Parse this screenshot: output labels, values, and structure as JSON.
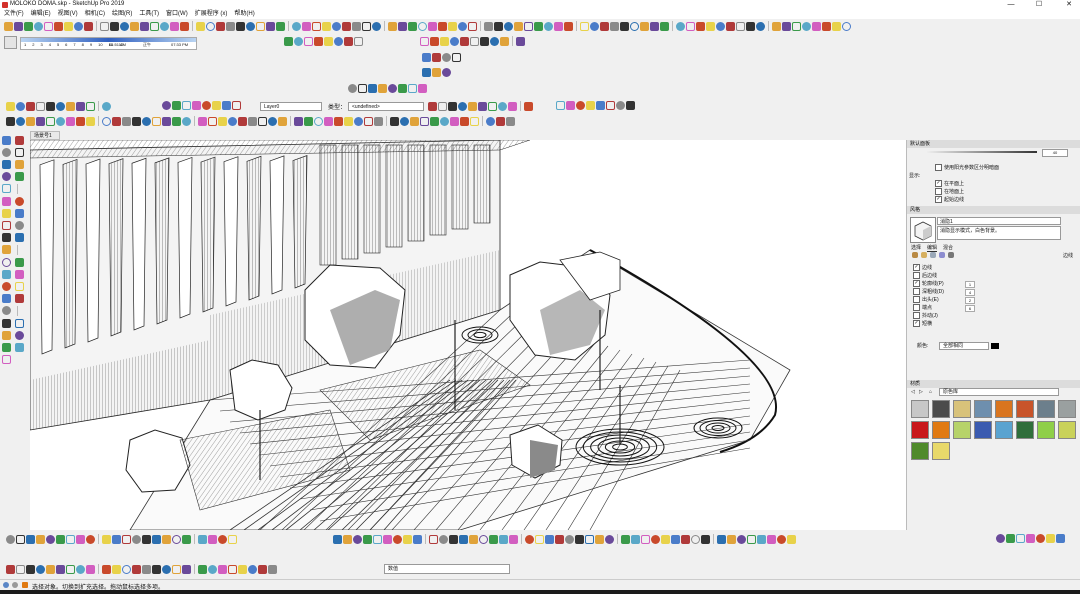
{
  "window": {
    "title": "MOLOKO DOMA.skp - SketchUp Pro 2019",
    "minimize": "—",
    "maximize": "☐",
    "close": "✕"
  },
  "menu": [
    "文件(F)",
    "编辑(E)",
    "视图(V)",
    "相机(C)",
    "绘图(R)",
    "工具(T)",
    "窗口(W)",
    "扩展程序 (x)",
    "帮助(H)"
  ],
  "shadow": {
    "months": [
      "1",
      "2",
      "3",
      "4",
      "5",
      "6",
      "7",
      "8",
      "9",
      "10",
      "11",
      "12"
    ],
    "start_time": "04:51 AM",
    "noon": "正午",
    "end_time": "07:33 PM"
  },
  "layer_bar": {
    "layer": "Layer0",
    "type_label": "类型：",
    "type_value": "<undefined>"
  },
  "scene_tab": "场景号1",
  "tray": {
    "default_panel": "默认面板",
    "slider_value": "40",
    "use_sun": "使用阳光参数区分明暗面",
    "display_label": "显示:",
    "display_options": [
      {
        "label": "在平面上",
        "checked": true
      },
      {
        "label": "在地面上",
        "checked": false
      },
      {
        "label": "起始边线",
        "checked": true
      }
    ],
    "styles_header": "风格",
    "style_name": "消隐1",
    "style_desc": "消隐显示模式，白色背景。",
    "tabs": [
      "选择",
      "编辑",
      "混合"
    ],
    "edge_label": "边线",
    "edge_settings": [
      {
        "label": "边线",
        "checked": true,
        "value": ""
      },
      {
        "label": "后边线",
        "checked": false,
        "value": ""
      },
      {
        "label": "轮廓线(P)",
        "checked": true,
        "value": "1"
      },
      {
        "label": "深粗线(D)",
        "checked": false,
        "value": "4"
      },
      {
        "label": "出头(E)",
        "checked": false,
        "value": "2"
      },
      {
        "label": "端点",
        "checked": false,
        "value": "6"
      },
      {
        "label": "抖动(J)",
        "checked": false,
        "value": ""
      },
      {
        "label": "短横",
        "checked": true,
        "value": ""
      }
    ],
    "color_label": "颜色:",
    "color_value": "全部相同",
    "materials_header": "材质",
    "materials_select": "原色库",
    "material_colors": [
      "#c7c7c7",
      "#4b4b4b",
      "#d8c27a",
      "#6e8fae",
      "#d9751f",
      "#c8542a",
      "#6c7f8c",
      "#9aa0a0",
      "#c8161a",
      "#e07a12",
      "#b7d36a",
      "#3b5bb0",
      "#5aa3d0",
      "#2f6e3b",
      "#8fcf49",
      "#c9d25a",
      "#4f8a2b",
      "#e8d96a"
    ]
  },
  "status": {
    "text": "选择对象。切换到扩充选择。拖动鼠标选择多项。",
    "measure_label": "数值"
  }
}
